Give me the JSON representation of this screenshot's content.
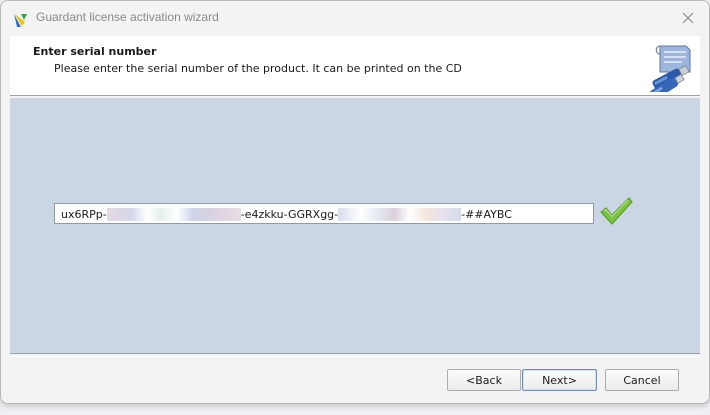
{
  "window": {
    "title": "Guardant license activation wizard",
    "close_icon": "close-icon"
  },
  "header": {
    "title": "Enter serial number",
    "subtitle": "Please enter the serial number of the product. It can be printed on the CD",
    "graphic_icon": "usb-keys-icon"
  },
  "serial": {
    "part1": "ux6RPp-",
    "part2": "-e4zkku-GGRXgg-",
    "part3": "-##AYBC",
    "status_icon": "checkmark-icon",
    "status_color": "#7cc242"
  },
  "buttons": {
    "back": "<Back",
    "next": "Next>",
    "cancel": "Cancel"
  },
  "colors": {
    "content_bg": "#cad6e4",
    "header_bg": "#ffffff"
  }
}
